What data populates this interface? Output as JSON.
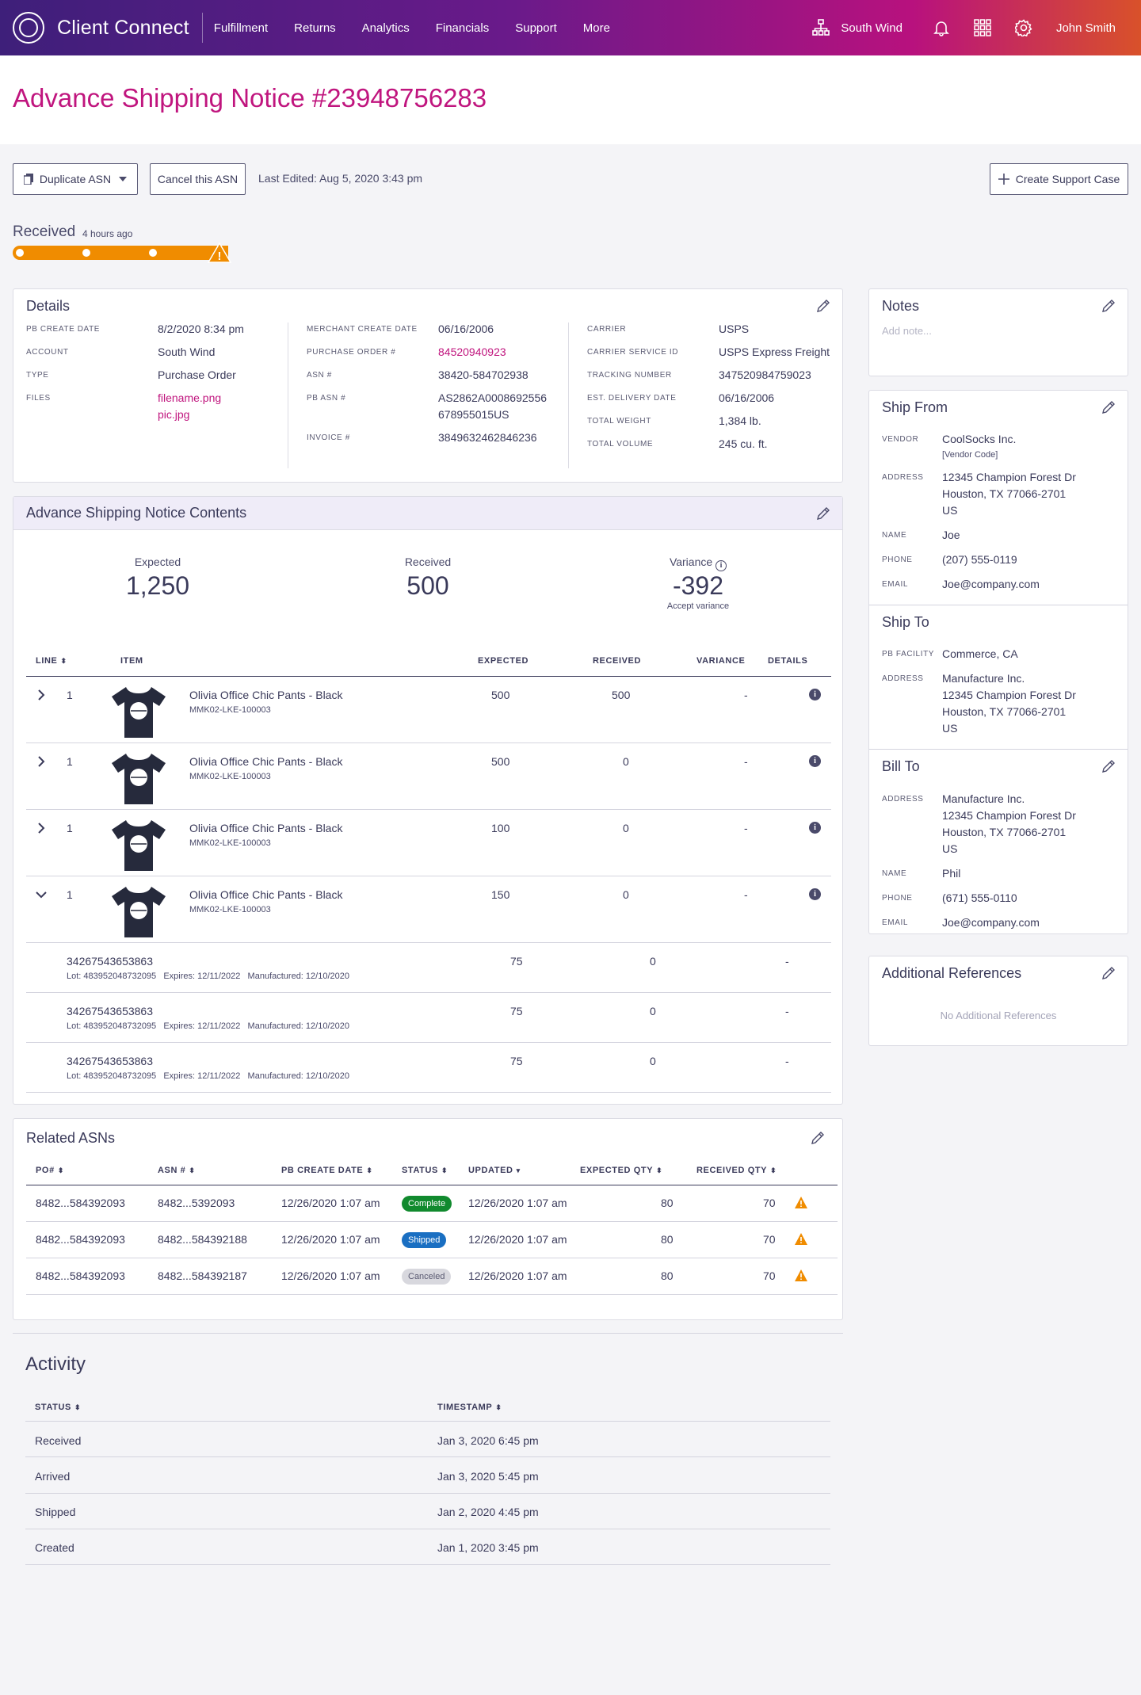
{
  "nav": {
    "brand": "Client Connect",
    "items": [
      "Fulfillment",
      "Returns",
      "Analytics",
      "Financials",
      "Support",
      "More"
    ],
    "org": "South Wind",
    "user": "John Smith"
  },
  "page": {
    "title": "Advance Shipping Notice #23948756283",
    "duplicate_label": "Duplicate ASN",
    "cancel_label": "Cancel this ASN",
    "last_edited": "Last Edited: Aug 5, 2020  3:43 pm",
    "support_label": "Create Support Case"
  },
  "status": {
    "label": "Received",
    "time": "4 hours ago",
    "progress": 1.0,
    "warning": "!"
  },
  "details": {
    "title": "Details",
    "col1": [
      {
        "label": "PB Create Date",
        "value": "8/2/2020  8:34 pm"
      },
      {
        "label": "Account",
        "value": "South Wind"
      },
      {
        "label": "Type",
        "value": "Purchase Order"
      },
      {
        "label": "Files",
        "value": "filename.png",
        "value2": "pic.jpg"
      }
    ],
    "col2": [
      {
        "label": "Merchant Create Date",
        "value": "06/16/2006"
      },
      {
        "label": "Purchase Order #",
        "value": "84520940923"
      },
      {
        "label": "ASN #",
        "value": "38420-584702938"
      },
      {
        "label": "PB ASN #",
        "value": "AS2862A0008692556",
        "value2": "678955015US"
      },
      {
        "label": "Invoice #",
        "value": "3849632462846236"
      }
    ],
    "col3": [
      {
        "label": "Carrier",
        "value": "USPS"
      },
      {
        "label": "Carrier Service ID",
        "value": "USPS Express Freight"
      },
      {
        "label": "Tracking Number",
        "value": "347520984759023"
      },
      {
        "label": "Est. Delivery Date",
        "value": "06/16/2006"
      },
      {
        "label": "Total Weight",
        "value": "1,384 lb."
      },
      {
        "label": "Total Volume",
        "value": "245 cu. ft."
      }
    ]
  },
  "contents": {
    "title": "Advance Shipping Notice Contents",
    "expected_label": "Expected",
    "expected": "1,250",
    "received_label": "Received",
    "received": "500",
    "variance_label": "Variance",
    "variance": "-392",
    "accept_variance": "Accept variance",
    "headers": {
      "line": "LINE",
      "item": "ITEM",
      "expected": "EXPECTED",
      "received": "RECEIVED",
      "variance": "VARIANCE",
      "details": "DETAILS"
    },
    "rows": [
      {
        "line": "1",
        "name": "Olivia Office Chic Pants - Black",
        "sku": "MMK02-LKE-100003",
        "expected": "500",
        "received": "500",
        "variance": "-",
        "expanded": false
      },
      {
        "line": "1",
        "name": "Olivia Office Chic Pants - Black",
        "sku": "MMK02-LKE-100003",
        "expected": "500",
        "received": "0",
        "variance": "-",
        "expanded": false
      },
      {
        "line": "1",
        "name": "Olivia Office Chic Pants - Black",
        "sku": "MMK02-LKE-100003",
        "expected": "100",
        "received": "0",
        "variance": "-",
        "expanded": false
      },
      {
        "line": "1",
        "name": "Olivia Office Chic Pants - Black",
        "sku": "MMK02-LKE-100003",
        "expected": "150",
        "received": "0",
        "variance": "-",
        "expanded": true
      }
    ],
    "subrows": [
      {
        "id": "34267543653863",
        "lot": "Lot: 483952048732095",
        "expires": "Expires: 12/11/2022",
        "manufactured": "Manufactured: 12/10/2020",
        "expected": "75",
        "received": "0",
        "variance": "-"
      },
      {
        "id": "34267543653863",
        "lot": "Lot: 483952048732095",
        "expires": "Expires: 12/11/2022",
        "manufactured": "Manufactured: 12/10/2020",
        "expected": "75",
        "received": "0",
        "variance": "-"
      },
      {
        "id": "34267543653863",
        "lot": "Lot: 483952048732095",
        "expires": "Expires: 12/11/2022",
        "manufactured": "Manufactured: 12/10/2020",
        "expected": "75",
        "received": "0",
        "variance": "-"
      }
    ]
  },
  "related": {
    "title": "Related ASNs",
    "headers": {
      "po": "PO#",
      "asn": "ASN #",
      "created": "PB CREATE DATE",
      "status": "STATUS",
      "updated": "UPDATED",
      "expected": "EXPECTED  QTY",
      "received": "RECEIVED QTY"
    },
    "rows": [
      {
        "po": "8482...584392093",
        "asn": "8482...5392093",
        "created": "12/26/2020 1:07 am",
        "status": "Complete",
        "status_color": "#118a2e",
        "updated": "12/26/2020  1:07 am",
        "expected": "80",
        "received": "70"
      },
      {
        "po": "8482...584392093",
        "asn": "8482...584392188",
        "created": "12/26/2020 1:07 am",
        "status": "Shipped",
        "status_color": "#1a6fc2",
        "updated": "12/26/2020  1:07 am",
        "expected": "80",
        "received": "70"
      },
      {
        "po": "8482...584392093",
        "asn": "8482...584392187",
        "created": "12/26/2020 1:07 am",
        "status": "Canceled",
        "status_color": "#d8d8de",
        "updated": "12/26/2020  1:07 am",
        "expected": "80",
        "received": "70"
      }
    ]
  },
  "activity": {
    "title": "Activity",
    "headers": {
      "status": "STATUS",
      "timestamp": "TIMESTAMP"
    },
    "rows": [
      {
        "status": "Received",
        "timestamp": "Jan 3, 2020  6:45 pm"
      },
      {
        "status": "Arrived",
        "timestamp": "Jan 3, 2020  5:45 pm"
      },
      {
        "status": "Shipped",
        "timestamp": "Jan 2, 2020  4:45 pm"
      },
      {
        "status": "Created",
        "timestamp": "Jan 1, 2020  3:45 pm"
      }
    ]
  },
  "notes": {
    "title": "Notes",
    "placeholder": "Add note..."
  },
  "ship_from": {
    "title": "Ship From",
    "vendor_label": "Vendor",
    "vendor": "CoolSocks Inc.",
    "vendor_code": "[Vendor Code]",
    "address_label": "Address",
    "address1": "12345 Champion Forest Dr",
    "address2": "Houston, TX 77066-2701",
    "address3": "US",
    "name_label": "Name",
    "name": "Joe",
    "phone_label": "Phone",
    "phone": "(207) 555-0119",
    "email_label": "Email",
    "email": "Joe@company.com"
  },
  "ship_to": {
    "title": "Ship To",
    "facility_label": "PB Facility",
    "facility": "Commerce, CA",
    "address_label": "Address",
    "address0": "Manufacture Inc.",
    "address1": "12345 Champion Forest Dr",
    "address2": "Houston, TX 77066-2701",
    "address3": "US"
  },
  "bill_to": {
    "title": "Bill To",
    "address_label": "Address",
    "address0": "Manufacture Inc.",
    "address1": "12345 Champion Forest Dr",
    "address2": "Houston, TX 77066-2701",
    "address3": "US",
    "name_label": "Name",
    "name": "Phil",
    "phone_label": "Phone",
    "phone": "(671) 555-0110",
    "email_label": "Email",
    "email": "Joe@company.com"
  },
  "additional": {
    "title": "Additional References",
    "empty": "No Additional References"
  },
  "colors": {
    "brand": "#c0157e",
    "warning": "#f08c00",
    "text": "#3a3a5a"
  }
}
